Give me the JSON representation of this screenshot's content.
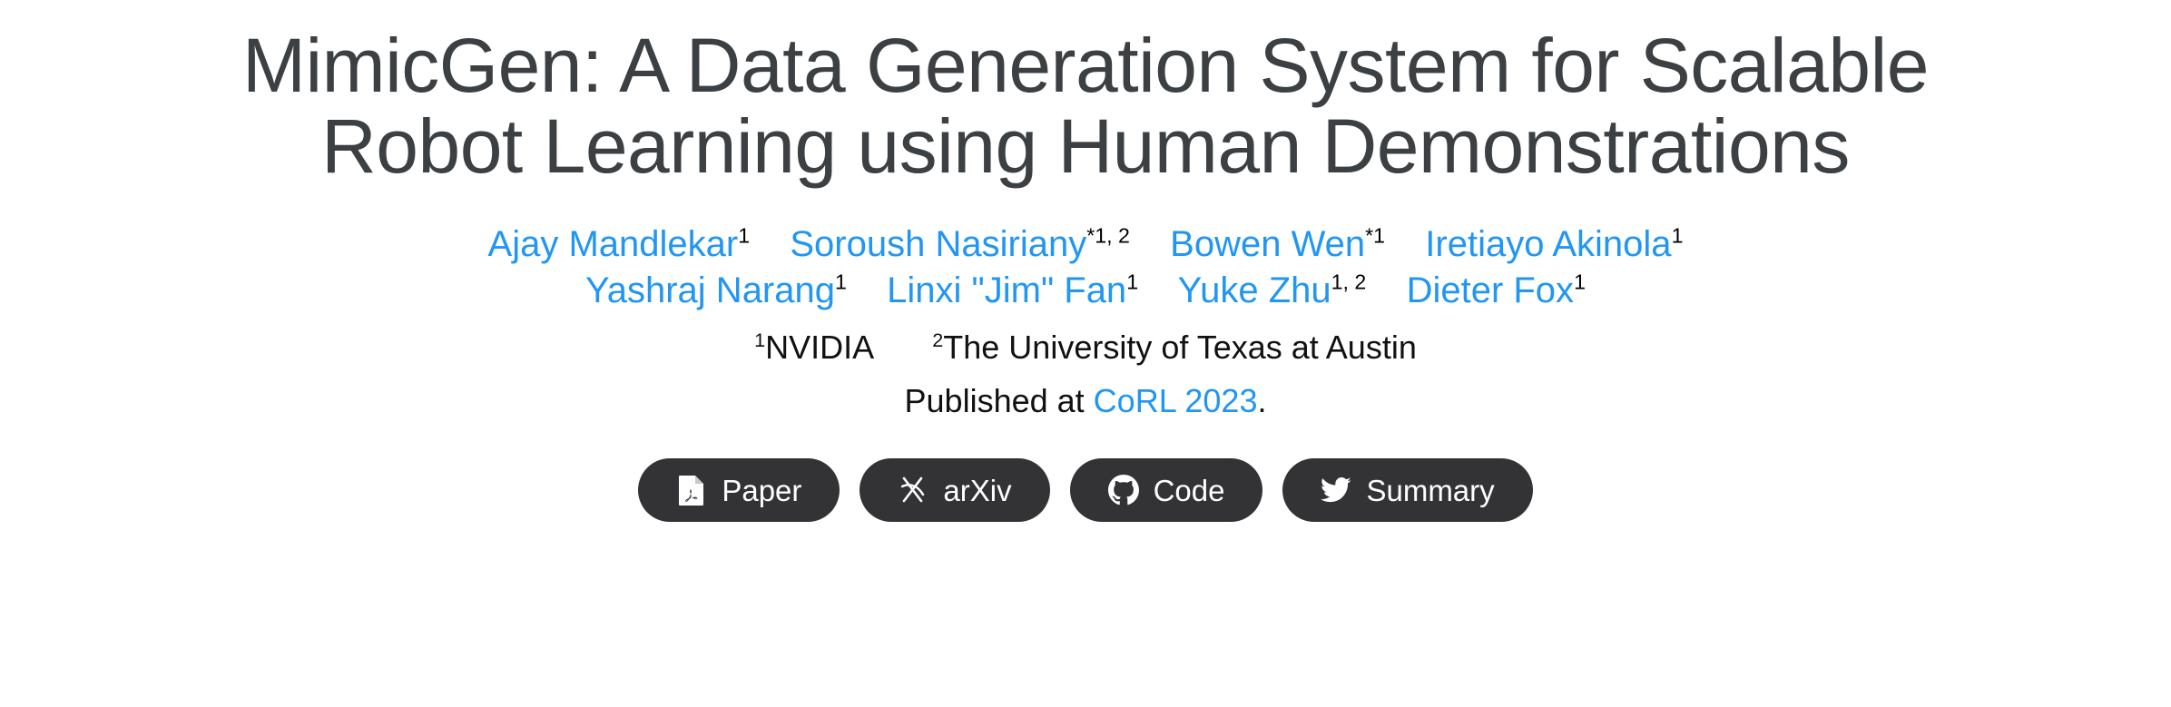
{
  "page": {
    "background_color": "#ffffff",
    "title_color": "#3c4043",
    "link_color": "#2196f3",
    "button_bg_color": "#333336",
    "button_text_color": "#ffffff"
  },
  "title": {
    "line1": "MimicGen: A Data Generation System for Scalable",
    "line2": "Robot Learning using Human Demonstrations"
  },
  "authors": {
    "row1": [
      {
        "name": "Ajay Mandlekar",
        "sup": "1"
      },
      {
        "name": "Soroush Nasiriany",
        "sup": "*1, 2"
      },
      {
        "name": "Bowen Wen",
        "sup": "*1"
      },
      {
        "name": "Iretiayo Akinola",
        "sup": "1"
      }
    ],
    "row2": [
      {
        "name": "Yashraj Narang",
        "sup": "1"
      },
      {
        "name": "Linxi \"Jim\" Fan",
        "sup": "1"
      },
      {
        "name": "Yuke Zhu",
        "sup": "1, 2"
      },
      {
        "name": "Dieter Fox",
        "sup": "1"
      }
    ]
  },
  "affiliations": [
    {
      "sup": "1",
      "name": "NVIDIA"
    },
    {
      "sup": "2",
      "name": "The University of Texas at Austin"
    }
  ],
  "venue": {
    "prefix": "Published at ",
    "link": "CoRL 2023",
    "suffix": "."
  },
  "buttons": [
    {
      "label": "Paper",
      "icon": "pdf-file-icon"
    },
    {
      "label": "arXiv",
      "icon": "arxiv-icon"
    },
    {
      "label": "Code",
      "icon": "github-icon"
    },
    {
      "label": "Summary",
      "icon": "twitter-bird-icon"
    }
  ]
}
